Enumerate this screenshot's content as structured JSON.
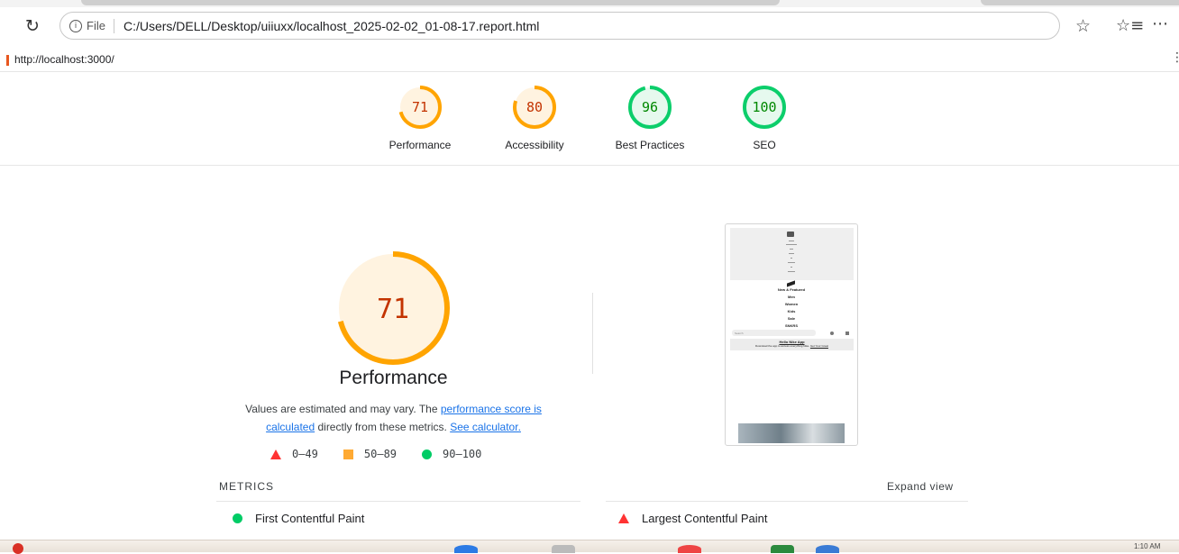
{
  "browser": {
    "address_url": "C:/Users/DELL/Desktop/uiiuxx/localhost_2025-02-02_01-08-17.report.html",
    "file_label": "File",
    "page_url": "http://localhost:3000/"
  },
  "gauges": [
    {
      "score": 71,
      "label": "Performance",
      "color": "#ffa400"
    },
    {
      "score": 80,
      "label": "Accessibility",
      "color": "#ffa400"
    },
    {
      "score": 96,
      "label": "Best Practices",
      "color": "#0cce6b"
    },
    {
      "score": 100,
      "label": "SEO",
      "color": "#0cce6b"
    }
  ],
  "performance": {
    "score": 71,
    "title": "Performance",
    "desc_prefix": "Values are estimated and may vary. The ",
    "desc_link1": "performance score is calculated",
    "desc_mid": " directly from these metrics. ",
    "desc_link2": "See calculator."
  },
  "legend": [
    {
      "range": "0–49",
      "shape": "triangle",
      "color": "#ff3333"
    },
    {
      "range": "50–89",
      "shape": "square",
      "color": "#ffaa33"
    },
    {
      "range": "90–100",
      "shape": "circle",
      "color": "#00cc66"
    }
  ],
  "screenshot": {
    "nav_items": [
      "New & Featured",
      "Men",
      "Women",
      "Kids",
      "Sale",
      "SNKRS"
    ],
    "search_placeholder": "Search",
    "banner_title": "Hello Nike App",
    "banner_text": "Download the app to access everything Nike.",
    "banner_link": "Get Your Great"
  },
  "metrics": {
    "heading": "METRICS",
    "expand_label": "Expand view",
    "items": [
      {
        "label": "First Contentful Paint",
        "status": "pass",
        "value_color": "#0cce6b"
      },
      {
        "label": "Largest Contentful Paint",
        "status": "fail",
        "value_color": "#ff3333"
      }
    ]
  },
  "taskbar": {
    "time": "1:10 AM"
  }
}
